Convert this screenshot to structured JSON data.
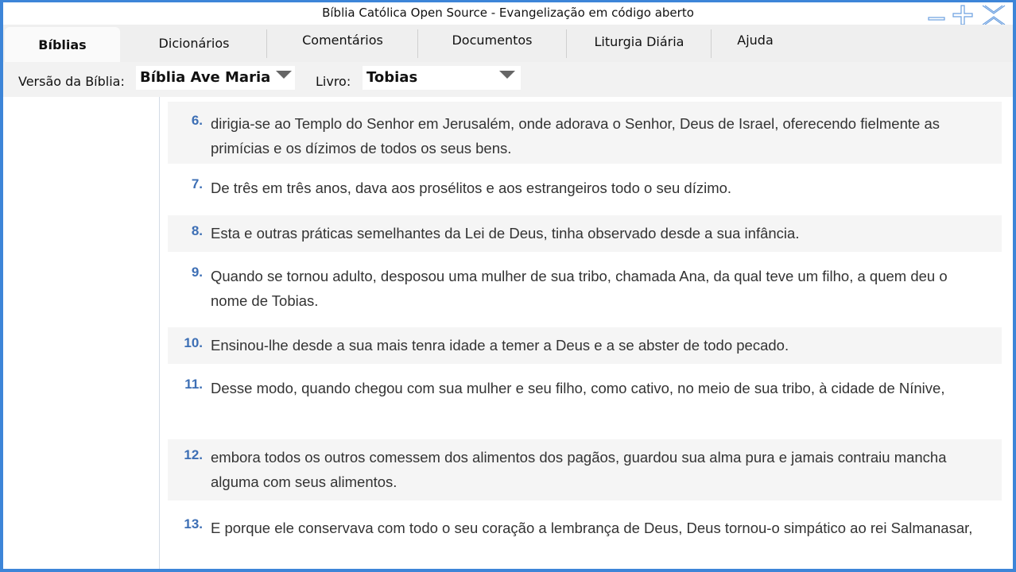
{
  "window": {
    "title": "Bíblia Católica Open Source - Evangelização em código aberto",
    "minimize_icon": "minimize-icon",
    "maximize_icon": "maximize-icon",
    "close_icon": "close-icon",
    "accent_color": "#3d85d8"
  },
  "tabs": [
    {
      "label": "Bíblias",
      "active": true
    },
    {
      "label": "Dicionários",
      "active": false
    },
    {
      "label": "Comentários",
      "active": false
    },
    {
      "label": "Documentos",
      "active": false
    },
    {
      "label": "Liturgia Diária",
      "active": false
    },
    {
      "label": "Ajuda",
      "active": false
    }
  ],
  "toolbar": {
    "version_label": "Versão da Bíblia:",
    "version_value": "Bíblia Ave Maria",
    "book_label": "Livro:",
    "book_value": "Tobias"
  },
  "verses": [
    {
      "number": "6.",
      "text": "dirigia-se ao Templo do Senhor em Jerusalém, onde adorava o Senhor, Deus de Israel, oferecendo fielmente as primícias e os dízimos de todos os seus bens."
    },
    {
      "number": "7.",
      "text": "De três em três anos, dava aos prosélitos e aos estrangeiros todo o seu dízimo."
    },
    {
      "number": "8.",
      "text": "Esta e outras práticas semelhantes da Lei de Deus, tinha observado desde a sua infância."
    },
    {
      "number": "9.",
      "text": "Quando se tornou adulto, desposou uma mulher de sua tribo, chamada Ana, da qual teve um filho, a quem deu o nome de Tobias."
    },
    {
      "number": "10.",
      "text": "Ensinou-lhe desde a sua mais tenra idade a temer a Deus e a se abster de todo pecado."
    },
    {
      "number": "11.",
      "text": "Desse modo, quando chegou com sua mulher e seu filho, como cativo, no meio de sua tribo, à cidade de Nínive,"
    },
    {
      "number": "12.",
      "text": "embora todos os outros comessem dos alimentos dos pagãos, guardou sua alma pura e jamais contraiu mancha alguma com seus alimentos."
    },
    {
      "number": "13.",
      "text": "E porque ele conservava com todo o seu coração a lembrança de Deus, Deus tornou-o simpático ao rei Salmanasar,"
    }
  ]
}
